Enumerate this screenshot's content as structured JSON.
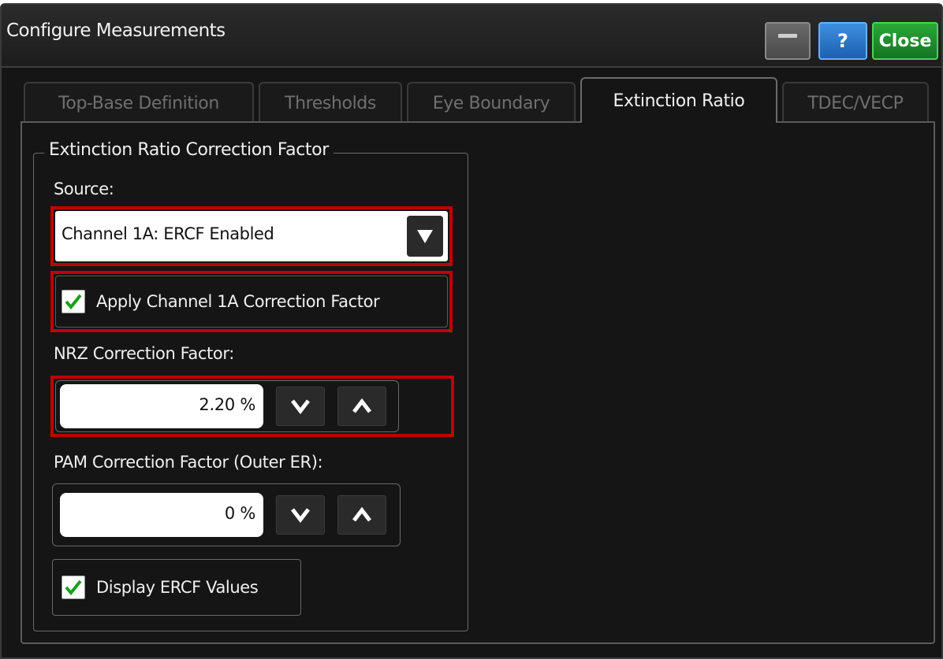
{
  "window": {
    "title": "Configure Measurements",
    "buttons": {
      "minimize_icon": "minimize-icon",
      "help_label": "?",
      "close_label": "Close"
    }
  },
  "tabs": [
    {
      "label": "Top-Base Definition",
      "active": false
    },
    {
      "label": "Thresholds",
      "active": false
    },
    {
      "label": "Eye Boundary",
      "active": false
    },
    {
      "label": "Extinction Ratio",
      "active": true
    },
    {
      "label": "TDEC/VECP",
      "active": false
    }
  ],
  "group": {
    "title": "Extinction Ratio Correction Factor",
    "source_label": "Source:",
    "source_value": "Channel 1A: ERCF Enabled",
    "apply_label": "Apply Channel 1A Correction Factor",
    "apply_checked": true,
    "nrz_label": "NRZ Correction Factor:",
    "nrz_value": "2.20 %",
    "pam_label": "PAM Correction Factor (Outer ER):",
    "pam_value": "0 %",
    "display_label": "Display ERCF Values",
    "display_checked": true
  },
  "colors": {
    "highlight": "#c00000",
    "close_button": "#1f8f2c",
    "help_button": "#2a78d0",
    "check": "#1aa01a"
  },
  "icons": {
    "dropdown": "dropdown-arrow-icon",
    "decrement": "chevron-down-icon",
    "increment": "chevron-up-icon",
    "check": "check-icon"
  }
}
